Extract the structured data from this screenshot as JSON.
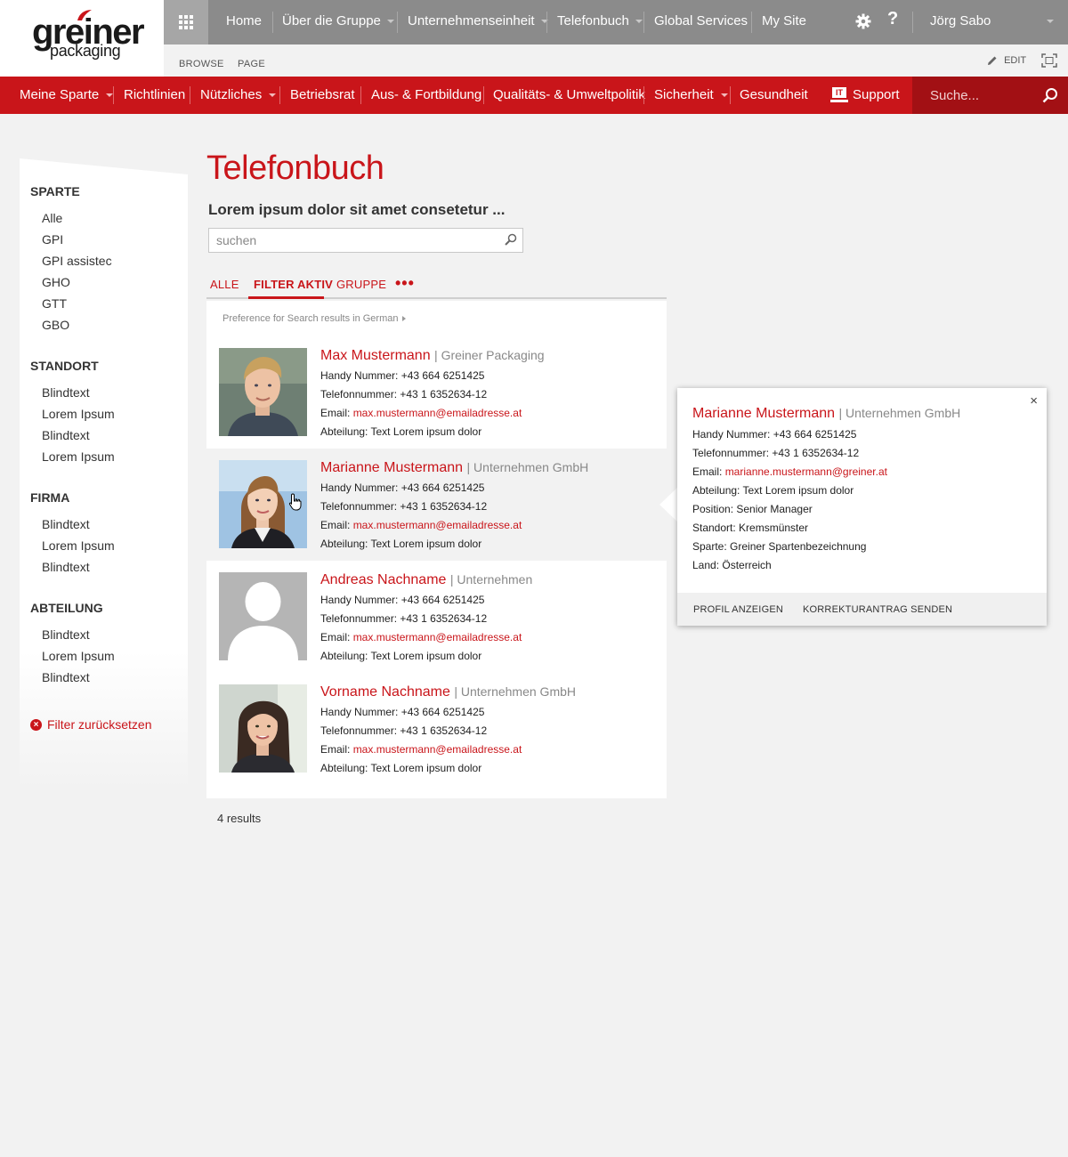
{
  "brand": {
    "logo_word": "greiner",
    "logo_sub": "packaging"
  },
  "suite_nav": {
    "items": [
      {
        "label": "Home",
        "dropdown": false
      },
      {
        "label": "Über die Gruppe",
        "dropdown": true
      },
      {
        "label": "Unternehmenseinheit",
        "dropdown": true
      },
      {
        "label": "Telefonbuch",
        "dropdown": true
      },
      {
        "label": "Global Services",
        "dropdown": false
      },
      {
        "label": "My Site",
        "dropdown": false
      }
    ],
    "user": "Jörg Sabo"
  },
  "ribbon": {
    "browse": "BROWSE",
    "page": "PAGE",
    "edit": "EDIT"
  },
  "main_nav": {
    "items": [
      {
        "label": "Meine Sparte",
        "dropdown": true
      },
      {
        "label": "Richtlinien",
        "dropdown": false
      },
      {
        "label": "Nützliches",
        "dropdown": true
      },
      {
        "label": "Betriebsrat",
        "dropdown": false
      },
      {
        "label": "Aus- & Fortbildung",
        "dropdown": false
      },
      {
        "label": "Qualitäts- & Umweltpolitik",
        "dropdown": false
      },
      {
        "label": "Sicherheit",
        "dropdown": true
      },
      {
        "label": "Gesundheit",
        "dropdown": false
      }
    ],
    "support": "Support",
    "support_badge": "IT",
    "search_placeholder": "Suche..."
  },
  "sidebar": {
    "groups": [
      {
        "title": "SPARTE",
        "items": [
          "Alle",
          "GPI",
          "GPI assistec",
          "GHO",
          "GTT",
          "GBO"
        ]
      },
      {
        "title": "STANDORT",
        "items": [
          "Blindtext",
          "Lorem Ipsum",
          "Blindtext",
          "Lorem Ipsum"
        ]
      },
      {
        "title": "FIRMA",
        "items": [
          "Blindtext",
          "Lorem Ipsum",
          "Blindtext"
        ]
      },
      {
        "title": "ABTEILUNG",
        "items": [
          "Blindtext",
          "Lorem Ipsum",
          "Blindtext"
        ]
      }
    ],
    "reset": "Filter zurücksetzen"
  },
  "page": {
    "title": "Telefonbuch",
    "subtitle": "Lorem ipsum dolor sit amet consetetur ...",
    "search_placeholder": "suchen",
    "tabs": [
      "ALLE",
      "FILTER AKTIV",
      "GRUPPE"
    ],
    "active_tab": "FILTER AKTIV",
    "preference": "Preference for Search results in German",
    "result_count": "4 results"
  },
  "results": [
    {
      "name": "Max Mustermann",
      "company": "| Greiner Packaging",
      "handy": "Handy Nummer: +43 664 6251425",
      "tel": "Telefonnummer: +43 1 6352634-12",
      "email_label": "Email: ",
      "email": "max.mustermann@emailadresse.at",
      "abteilung": "Abteilung: Text Lorem ipsum dolor",
      "photo": "man-blond"
    },
    {
      "name": "Marianne Mustermann",
      "company": "| Unternehmen GmbH",
      "handy": "Handy Nummer: +43 664 6251425",
      "tel": "Telefonnummer: +43 1 6352634-12",
      "email_label": "Email: ",
      "email": "max.mustermann@emailadresse.at",
      "abteilung": "Abteilung: Text Lorem ipsum dolor",
      "photo": "woman-blonde"
    },
    {
      "name": "Andreas Nachname",
      "company": "| Unternehmen",
      "handy": "Handy Nummer: +43 664 6251425",
      "tel": "Telefonnummer: +43 1 6352634-12",
      "email_label": "Email: ",
      "email": "max.mustermann@emailadresse.at",
      "abteilung": "Abteilung: Text Lorem ipsum dolor",
      "photo": "placeholder"
    },
    {
      "name": "Vorname Nachname",
      "company": "| Unternehmen GmbH",
      "handy": "Handy Nummer: +43 664 6251425",
      "tel": "Telefonnummer: +43 1 6352634-12",
      "email_label": "Email: ",
      "email": "max.mustermann@emailadresse.at",
      "abteilung": "Abteilung: Text Lorem ipsum dolor",
      "photo": "woman-brunette"
    }
  ],
  "popup": {
    "name": "Marianne Mustermann",
    "company": "| Unternehmen GmbH",
    "handy": "Handy Nummer: +43 664 6251425",
    "tel": "Telefonnummer: +43 1 6352634-12",
    "email_label": "Email: ",
    "email": "marianne.mustermann@greiner.at",
    "abteilung": "Abteilung: Text Lorem ipsum dolor",
    "position": "Position: Senior Manager",
    "standort": "Standort: Kremsmünster",
    "sparte": "Sparte: Greiner Spartenbezeichnung",
    "land": "Land: Österreich",
    "close": "×",
    "btn_profile": "PROFIL ANZEIGEN",
    "btn_correction": "KORREKTURANTRAG SENDEN"
  },
  "colors": {
    "brand_red": "#c9151a",
    "dark_red": "#a21014",
    "suite_gray": "#8b8b8b"
  }
}
